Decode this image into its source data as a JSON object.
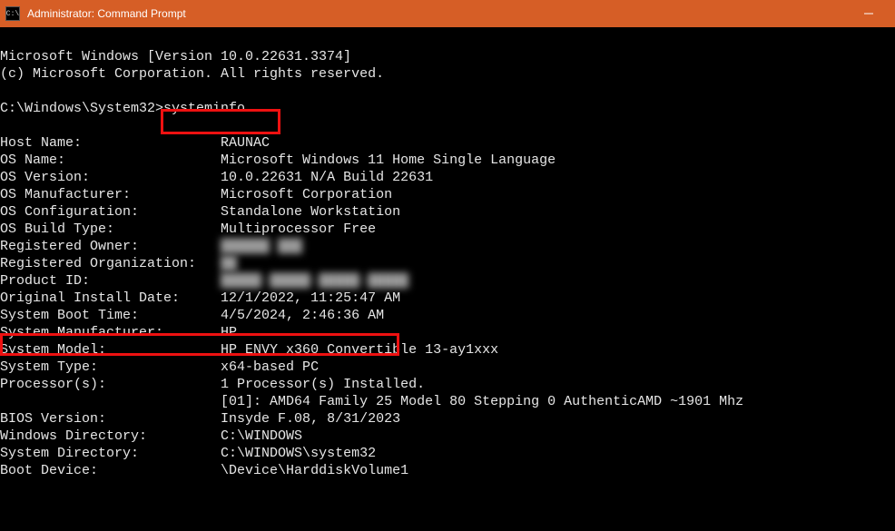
{
  "titlebar": {
    "icon_text": "C:\\",
    "title": "Administrator: Command Prompt"
  },
  "header": {
    "line1": "Microsoft Windows [Version 10.0.22631.3374]",
    "line2": "(c) Microsoft Corporation. All rights reserved."
  },
  "prompt": {
    "path": "C:\\Windows\\System32>",
    "command": "systeminfo"
  },
  "info": [
    {
      "label": "Host Name:",
      "value": "RAUNAC"
    },
    {
      "label": "OS Name:",
      "value": "Microsoft Windows 11 Home Single Language"
    },
    {
      "label": "OS Version:",
      "value": "10.0.22631 N/A Build 22631"
    },
    {
      "label": "OS Manufacturer:",
      "value": "Microsoft Corporation"
    },
    {
      "label": "OS Configuration:",
      "value": "Standalone Workstation"
    },
    {
      "label": "OS Build Type:",
      "value": "Multiprocessor Free"
    },
    {
      "label": "Registered Owner:",
      "value": "██████ ███",
      "blurred": true
    },
    {
      "label": "Registered Organization:",
      "value": "██",
      "blurred": true
    },
    {
      "label": "Product ID:",
      "value": "█████-█████-█████-█████",
      "blurred": true
    },
    {
      "label": "Original Install Date:",
      "value": "12/1/2022, 11:25:47 AM"
    },
    {
      "label": "System Boot Time:",
      "value": "4/5/2024, 2:46:36 AM"
    },
    {
      "label": "System Manufacturer:",
      "value": "HP"
    },
    {
      "label": "System Model:",
      "value": "HP ENVY x360 Convertible 13-ay1xxx"
    },
    {
      "label": "System Type:",
      "value": "x64-based PC"
    },
    {
      "label": "Processor(s):",
      "value": "1 Processor(s) Installed."
    },
    {
      "label": "",
      "value": "[01]: AMD64 Family 25 Model 80 Stepping 0 AuthenticAMD ~1901 Mhz"
    },
    {
      "label": "BIOS Version:",
      "value": "Insyde F.08, 8/31/2023"
    },
    {
      "label": "Windows Directory:",
      "value": "C:\\WINDOWS"
    },
    {
      "label": "System Directory:",
      "value": "C:\\WINDOWS\\system32"
    },
    {
      "label": "Boot Device:",
      "value": "\\Device\\HarddiskVolume1"
    }
  ]
}
